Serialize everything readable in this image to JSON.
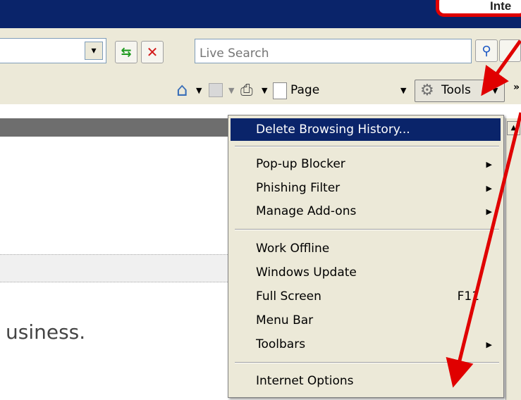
{
  "toolbar": {
    "search_placeholder": "Live Search",
    "page_label": "Page",
    "tools_label": "Tools",
    "overflow": "»"
  },
  "menu": {
    "items": [
      {
        "label": "Delete Browsing History...",
        "highlighted": true
      },
      {
        "label": "Pop-up Blocker",
        "submenu": true
      },
      {
        "label": "Phishing Filter",
        "submenu": true
      },
      {
        "label": "Manage Add-ons",
        "submenu": true
      },
      {
        "label": "Work Offline"
      },
      {
        "label": "Windows Update"
      },
      {
        "label": "Full Screen",
        "shortcut": "F11"
      },
      {
        "label": "Menu Bar"
      },
      {
        "label": "Toolbars",
        "submenu": true
      },
      {
        "label": "Internet Options"
      }
    ]
  },
  "content": {
    "partial_text": "usiness."
  },
  "callout": {
    "text": "Inte"
  },
  "colors": {
    "highlight": "#0a246a",
    "annotation": "#e00000",
    "chrome": "#ece9d8"
  },
  "icons": [
    "home-icon",
    "feeds-icon",
    "print-icon",
    "page-icon",
    "tools-gear-icon",
    "refresh-icon",
    "stop-icon",
    "search-go-icon"
  ]
}
